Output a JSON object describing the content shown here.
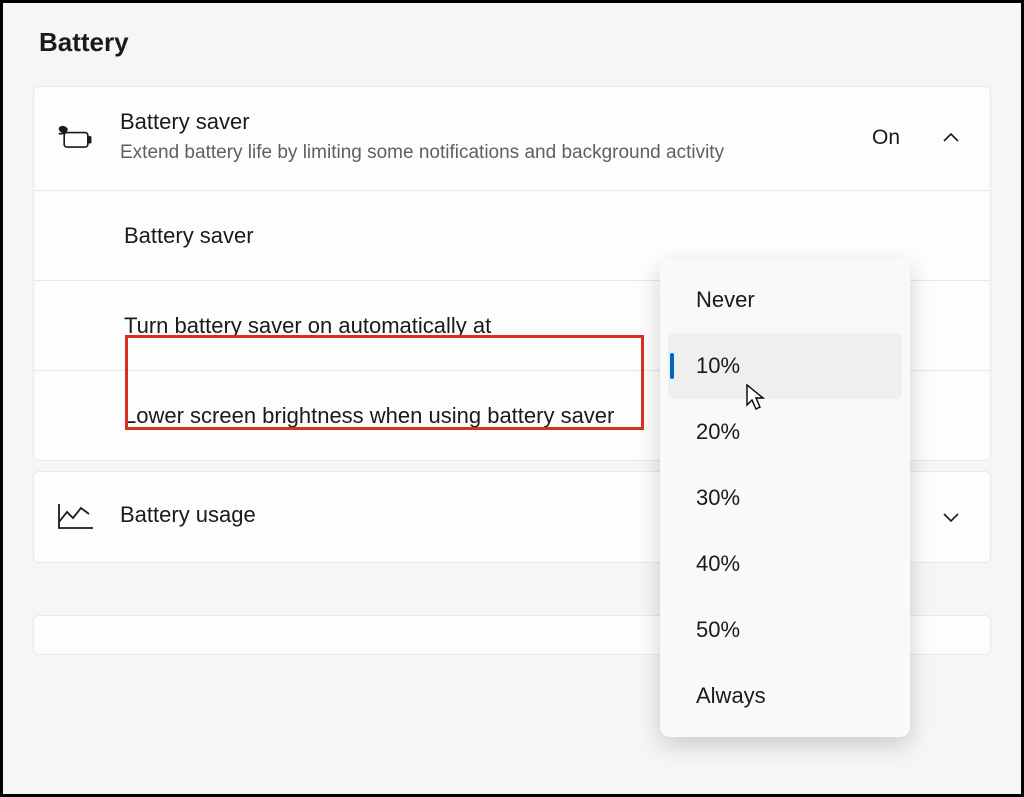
{
  "page": {
    "title": "Battery"
  },
  "batterySaver": {
    "title": "Battery saver",
    "description": "Extend battery life by limiting some notifications and background activity",
    "status": "On",
    "rows": {
      "toggle": {
        "label": "Battery saver"
      },
      "autoOn": {
        "label": "Turn battery saver on automatically at"
      },
      "brightness": {
        "label": "Lower screen brightness when using battery saver"
      }
    }
  },
  "batteryUsage": {
    "title": "Battery usage"
  },
  "dropdown": {
    "options": [
      "Never",
      "10%",
      "20%",
      "30%",
      "40%",
      "50%",
      "Always"
    ],
    "selected": "10%"
  }
}
